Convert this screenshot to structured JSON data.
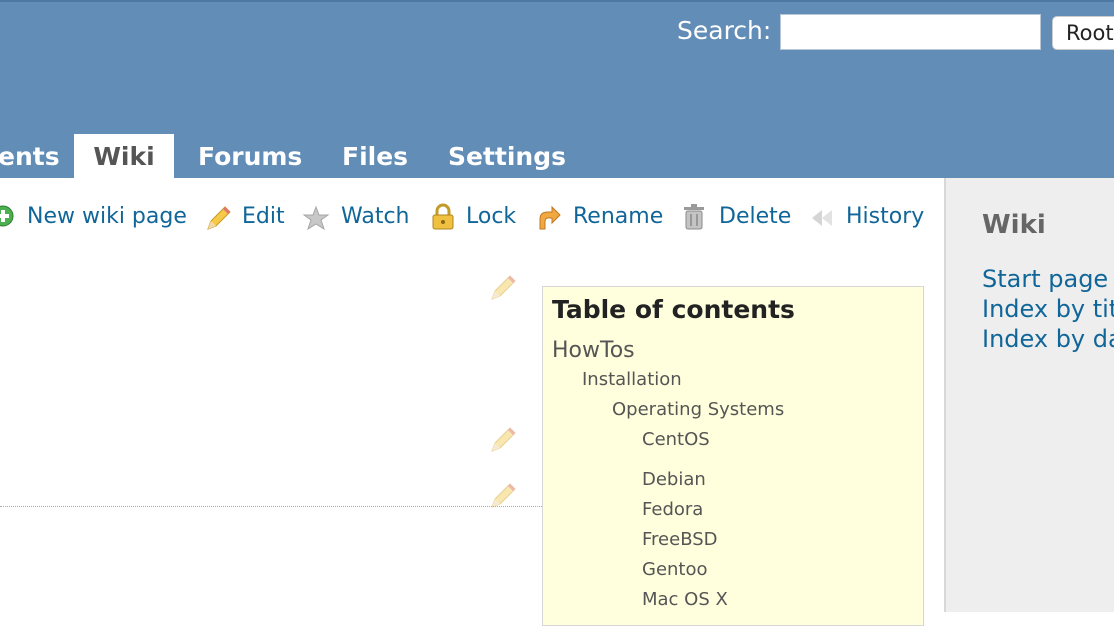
{
  "search": {
    "label": "Search:",
    "value": "",
    "placeholder": ""
  },
  "project_jump": {
    "label": "Root"
  },
  "tabs": [
    {
      "label": "ents"
    },
    {
      "label": "Wiki",
      "selected": true
    },
    {
      "label": "Forums"
    },
    {
      "label": "Files"
    },
    {
      "label": "Settings"
    }
  ],
  "contextual": {
    "new_page": "New wiki page",
    "edit": "Edit",
    "watch": "Watch",
    "lock": "Lock",
    "rename": "Rename",
    "delete": "Delete",
    "history": "History"
  },
  "toc": {
    "title": "Table of contents",
    "items": [
      {
        "label": "HowTos",
        "level": 1
      },
      {
        "label": "Installation",
        "level": 2
      },
      {
        "label": "Operating Systems",
        "level": 3
      },
      {
        "label": "CentOS",
        "level": 4
      },
      {
        "label": "Debian",
        "level": 4
      },
      {
        "label": "Fedora",
        "level": 4
      },
      {
        "label": "FreeBSD",
        "level": 4
      },
      {
        "label": "Gentoo",
        "level": 4
      },
      {
        "label": "Mac OS X",
        "level": 4
      }
    ]
  },
  "sidebar": {
    "title": "Wiki",
    "links": [
      {
        "label": "Start page"
      },
      {
        "label": "Index by title"
      },
      {
        "label": "Index by date"
      }
    ]
  },
  "colors": {
    "header_bg": "#628DB6",
    "link": "#116699",
    "toc_bg": "#FFFFDD",
    "sidebar_bg": "#EEEEEE"
  }
}
